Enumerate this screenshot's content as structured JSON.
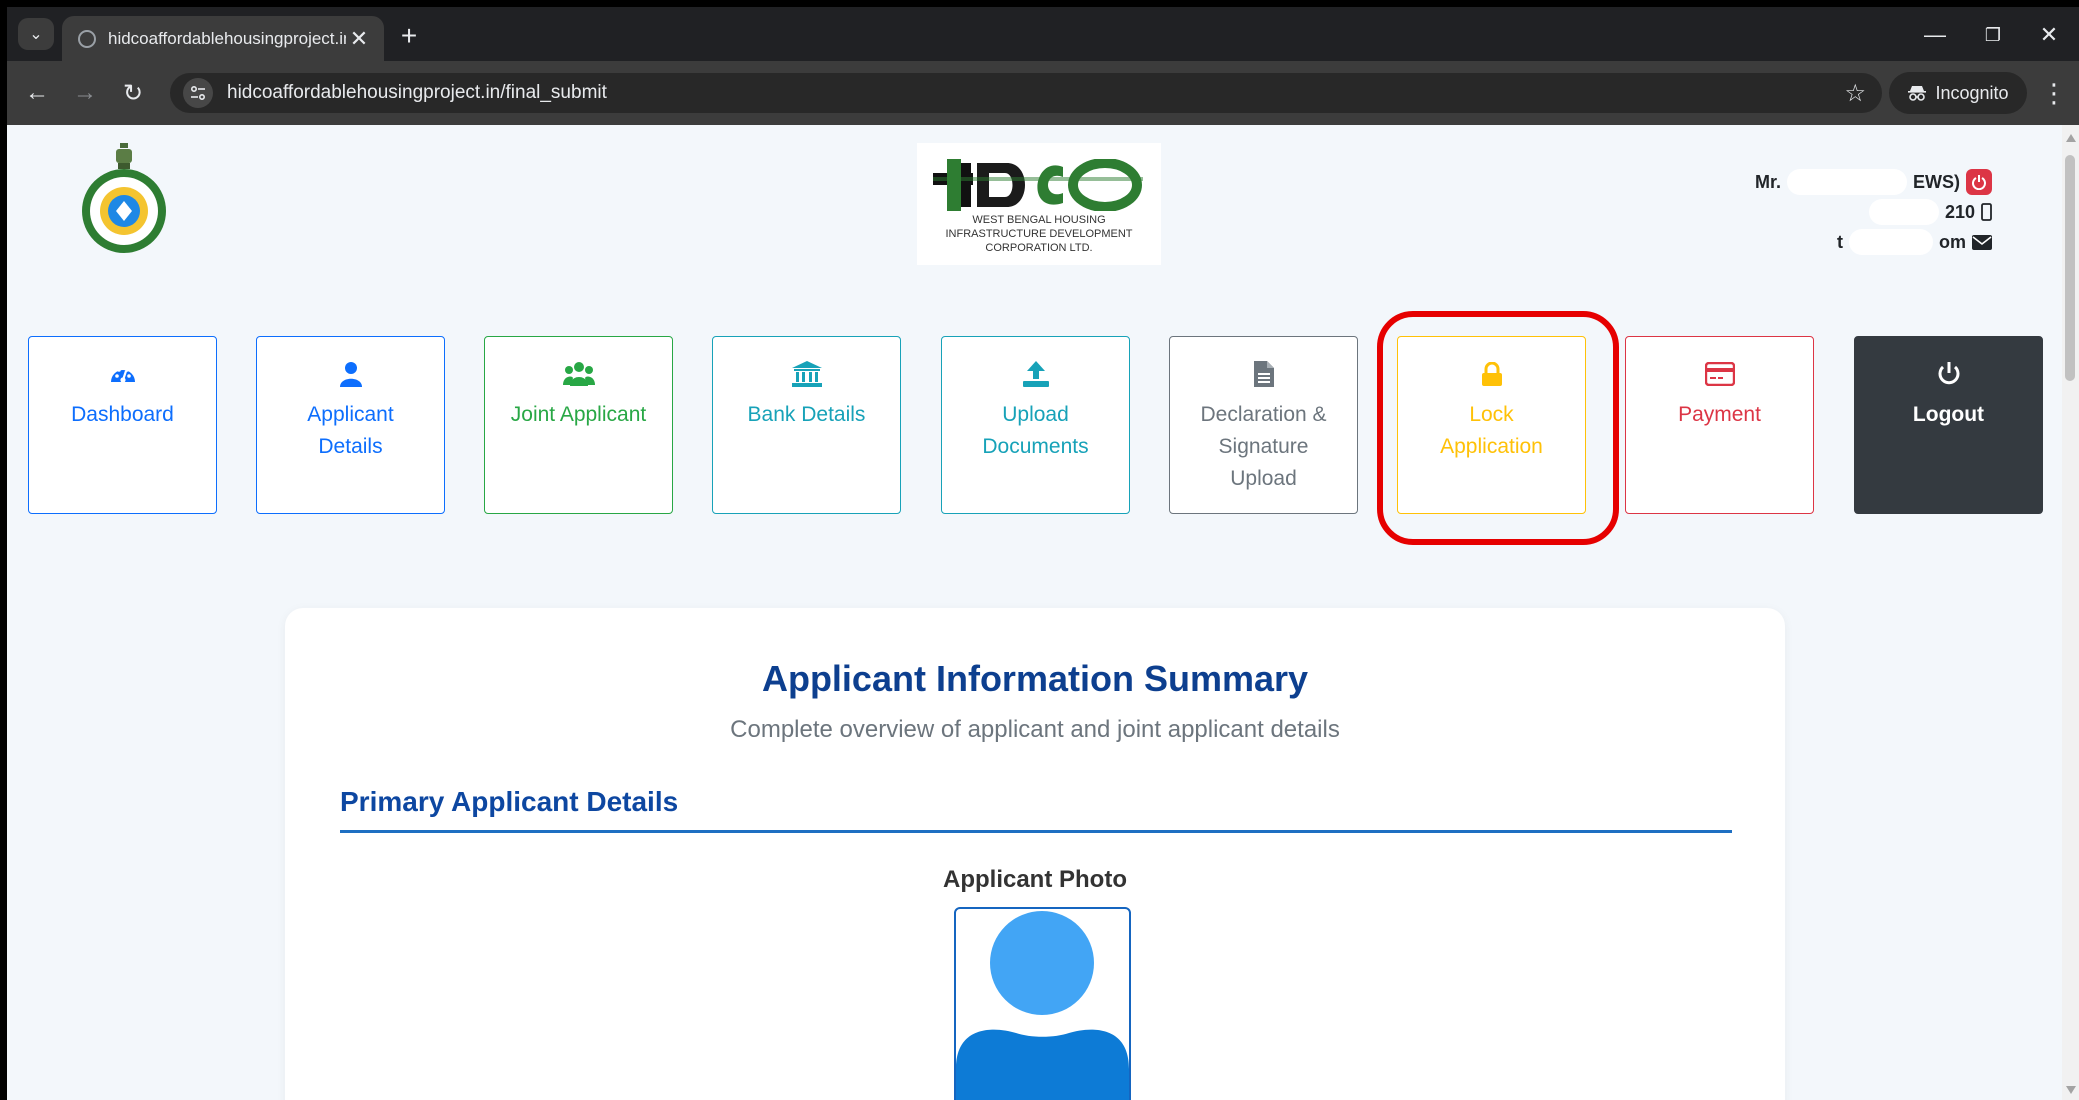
{
  "browser": {
    "tab_title": "hidcoaffordablehousingproject.in",
    "tab_close": "✕",
    "new_tab": "+",
    "url": "hidcoaffordablehousingproject.in/final_submit",
    "incognito_label": "Incognito",
    "minimize": "—",
    "restore": "❐",
    "close": "✕",
    "back": "←",
    "forward": "→",
    "reload": "↻",
    "star": "☆",
    "menu": "⋮",
    "tab_search": "⌄"
  },
  "header": {
    "hidco_logo_text": "HIDCO",
    "hidco_subtitle_1": "WEST BENGAL HOUSING",
    "hidco_subtitle_2": "INFRASTRUCTURE DEVELOPMENT",
    "hidco_subtitle_3": "CORPORATION LTD.",
    "user": {
      "name_prefix": "Mr.",
      "name_suffix": "EWS)",
      "phone_suffix": "210",
      "email_prefix": "t",
      "email_suffix": "om"
    }
  },
  "nav_cards": [
    {
      "label": "Dashboard",
      "icon": "dashboard-icon",
      "color": "#0d6efd"
    },
    {
      "label": "Applicant\nDetails",
      "icon": "user-icon",
      "color": "#0d6efd"
    },
    {
      "label": "Joint Applicant",
      "icon": "users-icon",
      "color": "#28a745"
    },
    {
      "label": "Bank Details",
      "icon": "bank-icon",
      "color": "#17a2b8"
    },
    {
      "label": "Upload\nDocuments",
      "icon": "upload-icon",
      "color": "#17a2b8"
    },
    {
      "label": "Declaration &\nSignature\nUpload",
      "icon": "file-icon",
      "color": "#6c757d"
    },
    {
      "label": "Lock\nApplication",
      "icon": "lock-icon",
      "color": "#ffc107"
    },
    {
      "label": "Payment",
      "icon": "credit-card-icon",
      "color": "#dc3545"
    },
    {
      "label": "Logout",
      "icon": "power-icon",
      "color": "#ffffff"
    }
  ],
  "summary": {
    "title": "Applicant Information Summary",
    "subtitle": "Complete overview of applicant and joint applicant details",
    "section_title": "Primary Applicant Details",
    "photo_label": "Applicant Photo"
  },
  "colors": {
    "highlight": "#e60000",
    "title_blue": "#0d3f8f"
  }
}
